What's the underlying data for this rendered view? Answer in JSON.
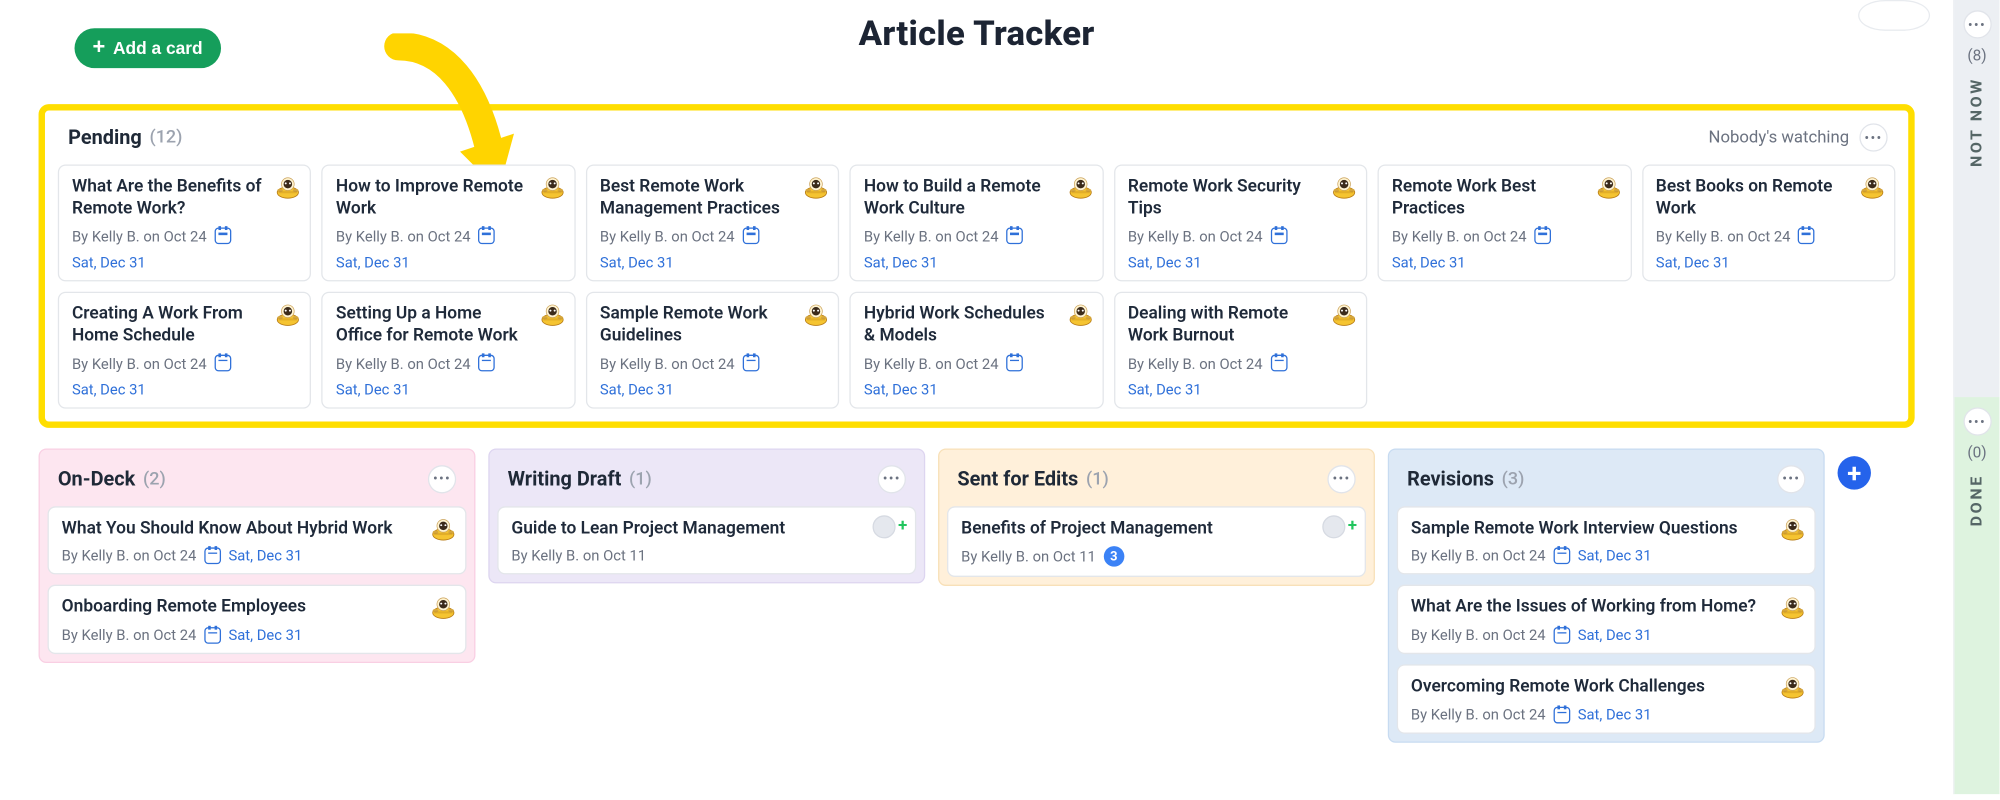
{
  "header": {
    "add_card_label": "Add a card",
    "title": "Article Tracker"
  },
  "pending": {
    "title": "Pending",
    "count": "(12)",
    "watch_text": "Nobody's watching",
    "items": [
      {
        "title": "What Are the Benefits of Remote Work?",
        "byline": "By Kelly B. on Oct 24",
        "due": "Sat, Dec 31"
      },
      {
        "title": "How to Improve Remote Work",
        "byline": "By Kelly B. on Oct 24",
        "due": "Sat, Dec 31"
      },
      {
        "title": "Best Remote Work Management Practices",
        "byline": "By Kelly B. on Oct 24",
        "due": "Sat, Dec 31"
      },
      {
        "title": "How to Build a Remote Work Culture",
        "byline": "By Kelly B. on Oct 24",
        "due": "Sat, Dec 31"
      },
      {
        "title": "Remote Work Security Tips",
        "byline": "By Kelly B. on Oct 24",
        "due": "Sat, Dec 31"
      },
      {
        "title": "Remote Work Best Practices",
        "byline": "By Kelly B. on Oct 24",
        "due": "Sat, Dec 31"
      },
      {
        "title": "Best Books on Remote Work",
        "byline": "By Kelly B. on Oct 24",
        "due": "Sat, Dec 31"
      },
      {
        "title": "Creating A Work From Home Schedule",
        "byline": "By Kelly B. on Oct 24",
        "due": "Sat, Dec 31"
      },
      {
        "title": "Setting Up a Home Office for Remote Work",
        "byline": "By Kelly B. on Oct 24",
        "due": "Sat, Dec 31"
      },
      {
        "title": "Sample Remote Work Guidelines",
        "byline": "By Kelly B. on Oct 24",
        "due": "Sat, Dec 31"
      },
      {
        "title": "Hybrid Work Schedules & Models",
        "byline": "By Kelly B. on Oct 24",
        "due": "Sat, Dec 31"
      },
      {
        "title": "Dealing with Remote Work Burnout",
        "byline": "By Kelly B. on Oct 24",
        "due": "Sat, Dec 31"
      }
    ]
  },
  "columns": {
    "ondeck": {
      "title": "On-Deck",
      "count": "(2)",
      "items": [
        {
          "title": "What You Should Know About Hybrid Work",
          "byline": "By Kelly B. on Oct 24",
          "due": "Sat, Dec 31"
        },
        {
          "title": "Onboarding Remote Employees",
          "byline": "By Kelly B. on Oct 24",
          "due": "Sat, Dec 31"
        }
      ]
    },
    "writing": {
      "title": "Writing Draft",
      "count": "(1)",
      "items": [
        {
          "title": "Guide to Lean Project Management",
          "byline": "By Kelly B. on Oct 11"
        }
      ]
    },
    "edits": {
      "title": "Sent for Edits",
      "count": "(1)",
      "items": [
        {
          "title": "Benefits of Project Management",
          "byline": "By Kelly B. on Oct 11",
          "badge": "3"
        }
      ]
    },
    "revisions": {
      "title": "Revisions",
      "count": "(3)",
      "items": [
        {
          "title": "Sample Remote Work Interview Questions",
          "byline": "By Kelly B. on Oct 24",
          "due": "Sat, Dec 31"
        },
        {
          "title": "What Are the Issues of Working from Home?",
          "byline": "By Kelly B. on Oct 24",
          "due": "Sat, Dec 31"
        },
        {
          "title": "Overcoming Remote Work Challenges",
          "byline": "By Kelly B. on Oct 24",
          "due": "Sat, Dec 31"
        }
      ]
    }
  },
  "side": {
    "notnow": {
      "label": "NOT NOW",
      "count": "(8)"
    },
    "done": {
      "label": "DONE",
      "count": "(0)"
    }
  }
}
